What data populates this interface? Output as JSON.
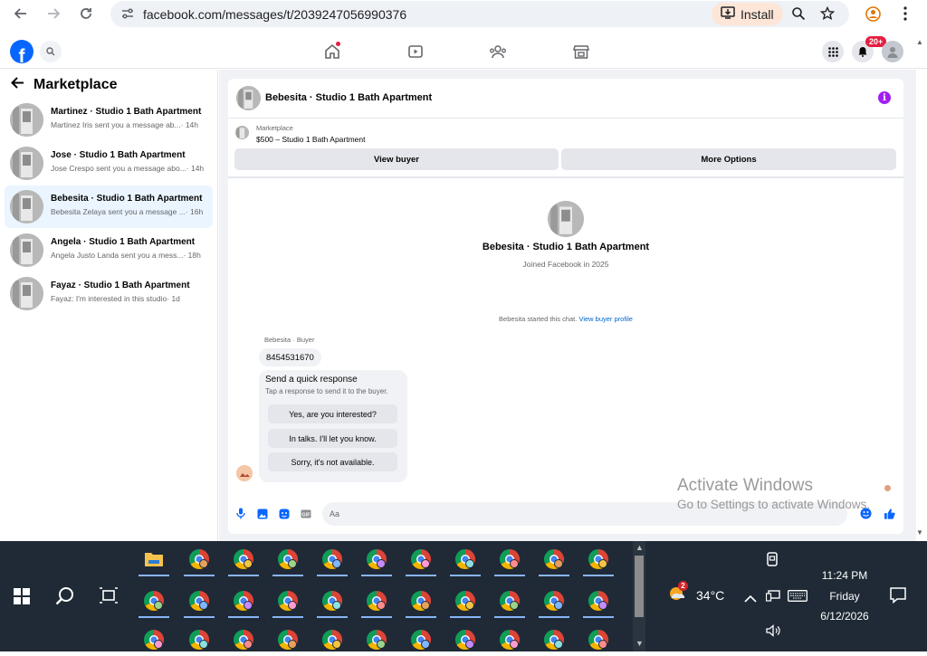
{
  "browser": {
    "url": "facebook.com/messages/t/2039247056990376",
    "install_label": "Install"
  },
  "facebook": {
    "notification_badge": "20+"
  },
  "sidebar": {
    "title": "Marketplace",
    "conversations": [
      {
        "title": "Martinez · Studio 1 Bath Apartment",
        "preview": "Martinez Iris sent you a message ab...",
        "time": "· 14h"
      },
      {
        "title": "Jose · Studio 1 Bath Apartment",
        "preview": "Jose Crespo sent you a message abo...",
        "time": "· 14h"
      },
      {
        "title": "Bebesita · Studio 1 Bath Apartment",
        "preview": "Bebesita Zelaya sent you a message ...",
        "time": "· 16h"
      },
      {
        "title": "Angela · Studio 1 Bath Apartment",
        "preview": "Angela Justo Landa sent you a mess...",
        "time": "· 18h"
      },
      {
        "title": "Fayaz · Studio 1 Bath Apartment",
        "preview": "Fayaz: I'm interested in this studio",
        "time": "· 1d"
      }
    ]
  },
  "chat": {
    "header_title": "Bebesita · Studio 1 Bath Apartment",
    "marketplace_label": "Marketplace",
    "listing": "$500 – Studio 1 Bath Apartment",
    "view_buyer_label": "View buyer",
    "more_options_label": "More Options",
    "center_name": "Bebesita · Studio 1 Bath Apartment",
    "joined": "Joined Facebook in 2025",
    "started_text": "Bebesita started this chat.",
    "view_profile_link": "View buyer profile",
    "sender_label": "Bebesita · Buyer",
    "phone_message": "8454531670",
    "quick_title": "Send a quick response",
    "quick_subtitle": "Tap a response to send it to the buyer.",
    "quick_replies": [
      "Yes, are you interested?",
      "In talks. I'll let you know.",
      "Sorry, it's not available."
    ],
    "composer_placeholder": "Aa"
  },
  "watermark": {
    "line1": "Activate Windows",
    "line2": "Go to Settings to activate Windows."
  },
  "taskbar": {
    "temperature": "34°C",
    "weather_badge": "2",
    "time": "11:24 PM",
    "day": "Friday",
    "date": "6/12/2026"
  }
}
